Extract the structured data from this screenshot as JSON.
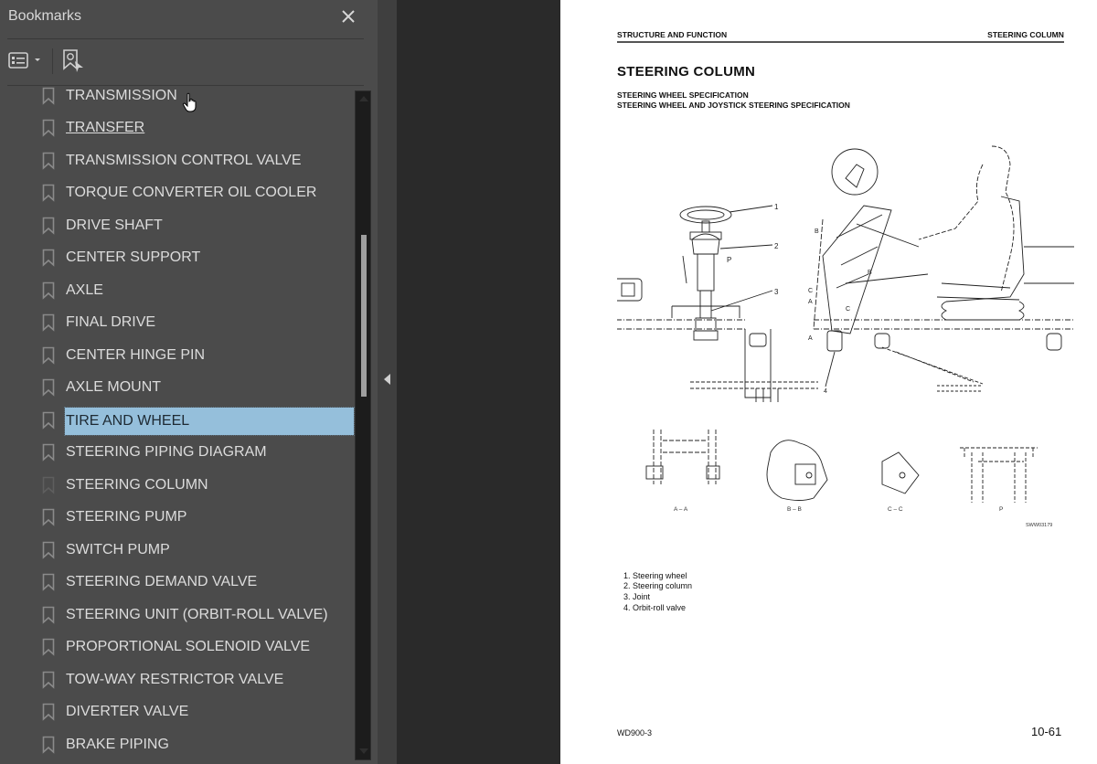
{
  "bookmarks_panel": {
    "title": "Bookmarks",
    "close_icon": "close-icon",
    "toolbar": {
      "options_icon": "list-options-icon",
      "find_bookmark_icon": "find-current-bookmark-icon"
    },
    "items": [
      {
        "label": "TRANSMISSION",
        "state": "hover"
      },
      {
        "label": "TRANSFER",
        "state": "underlined"
      },
      {
        "label": "TRANSMISSION CONTROL VALVE"
      },
      {
        "label": "TORQUE CONVERTER OIL COOLER"
      },
      {
        "label": "DRIVE SHAFT"
      },
      {
        "label": "CENTER SUPPORT"
      },
      {
        "label": "AXLE"
      },
      {
        "label": "FINAL DRIVE"
      },
      {
        "label": "CENTER HINGE PIN"
      },
      {
        "label": "AXLE MOUNT"
      },
      {
        "label": "TIRE AND WHEEL",
        "state": "selected"
      },
      {
        "label": "STEERING PIPING DIAGRAM"
      },
      {
        "label": "STEERING COLUMN",
        "state": "current"
      },
      {
        "label": "STEERING PUMP"
      },
      {
        "label": "SWITCH PUMP"
      },
      {
        "label": "STEERING DEMAND VALVE"
      },
      {
        "label": "STEERING UNIT (ORBIT-ROLL VALVE)"
      },
      {
        "label": "PROPORTIONAL SOLENOID VALVE"
      },
      {
        "label": "TOW-WAY RESTRICTOR VALVE"
      },
      {
        "label": "DIVERTER VALVE"
      },
      {
        "label": "BRAKE PIPING"
      }
    ],
    "colors": {
      "panel_bg": "#4b4b4b",
      "selection_bg": "#95bfdb",
      "text": "#dcdcdc"
    }
  },
  "document": {
    "header_left": "STRUCTURE AND FUNCTION",
    "header_right": "STEERING COLUMN",
    "title": "STEERING COLUMN",
    "subtitle_1": "STEERING WHEEL SPECIFICATION",
    "subtitle_2": "STEERING WHEEL AND JOYSTICK STEERING SPECIFICATION",
    "diagram": {
      "callouts": [
        "1",
        "2",
        "3",
        "4"
      ],
      "view_marks": [
        "A",
        "B",
        "C",
        "P"
      ],
      "section_labels": [
        "A – A",
        "B – B",
        "C – C",
        "P"
      ],
      "figure_code": "SWW03179"
    },
    "legend": [
      "1. Steering wheel",
      "2. Steering column",
      "3. Joint",
      "4. Orbit-roll valve"
    ],
    "footer_model": "WD900-3",
    "footer_page": "10-61"
  }
}
